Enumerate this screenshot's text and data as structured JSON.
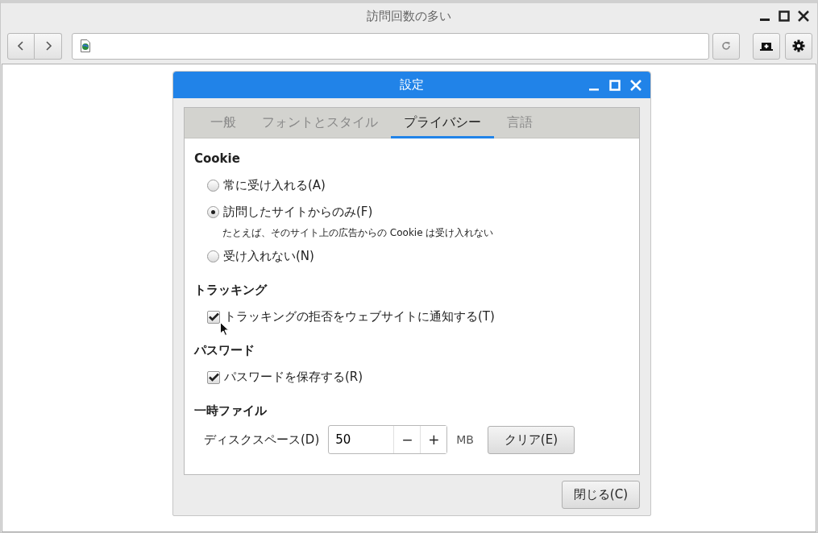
{
  "window": {
    "title": "訪問回数の多い"
  },
  "dialog": {
    "title": "設定",
    "tabs": [
      {
        "label": "一般",
        "selected": false
      },
      {
        "label": "フォントとスタイル",
        "selected": false
      },
      {
        "label": "プライバシー",
        "selected": true
      },
      {
        "label": "言語",
        "selected": false
      }
    ],
    "sections": [
      {
        "heading": "Cookie",
        "items": [
          {
            "kind": "radio",
            "label": "常に受け入れる(A)",
            "selected": false
          },
          {
            "kind": "radio",
            "label": "訪問したサイトからのみ(F)",
            "selected": true
          },
          {
            "kind": "note",
            "text": "たとえば、そのサイト上の広告からの Cookie は受け入れない"
          },
          {
            "kind": "radio",
            "label": "受け入れない(N)",
            "selected": false
          }
        ]
      },
      {
        "heading": "トラッキング",
        "items": [
          {
            "kind": "checkbox",
            "label": "トラッキングの拒否をウェブサイトに通知する(T)",
            "checked": true
          }
        ]
      },
      {
        "heading": "パスワード",
        "items": [
          {
            "kind": "checkbox",
            "label": "パスワードを保存する(R)",
            "checked": true
          }
        ]
      },
      {
        "heading": "一時ファイル",
        "items": [
          {
            "kind": "spin",
            "label": "ディスクスペース(D)",
            "value": "50",
            "minus": "−",
            "plus": "+",
            "unit": "MB",
            "button": "クリア(E)"
          }
        ]
      }
    ],
    "close_button": "閉じる(C)"
  }
}
